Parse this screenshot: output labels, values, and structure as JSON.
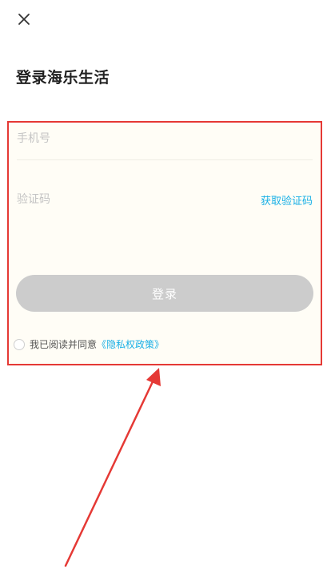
{
  "header": {
    "close_icon": "close-icon"
  },
  "title": "登录海乐生活",
  "form": {
    "phone_placeholder": "手机号",
    "code_placeholder": "验证码",
    "get_code_label": "获取验证码",
    "login_label": "登录",
    "agree_text": "我已阅读并同意",
    "privacy_link": "《隐私权政策》"
  },
  "colors": {
    "accent": "#1ab0e6",
    "button_disabled": "#cccccc",
    "annotation": "#e53935"
  }
}
